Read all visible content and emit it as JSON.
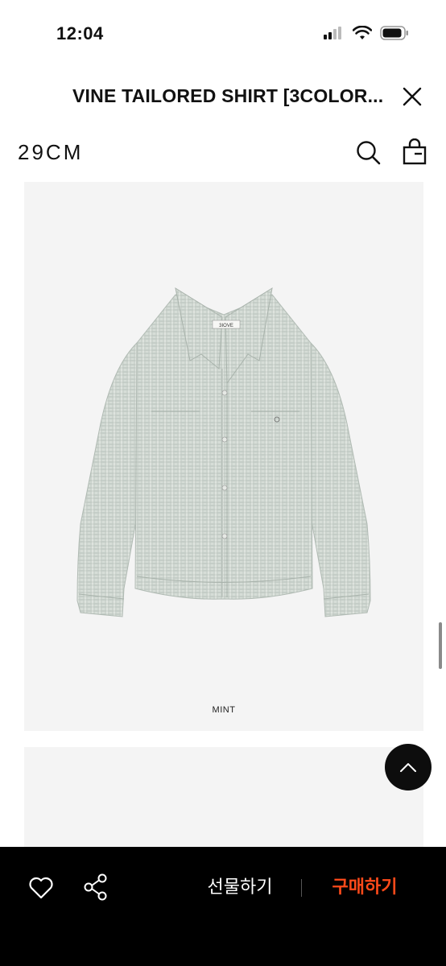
{
  "status_bar": {
    "time": "12:04",
    "icons": [
      "signal-icon",
      "wifi-icon",
      "battery-icon"
    ]
  },
  "modal": {
    "title": "VINE TAILORED SHIRT [3COLOR...",
    "close_icon": "close-icon"
  },
  "header": {
    "brand": "29CM",
    "icons": [
      "search-icon",
      "shopping-bag-icon"
    ]
  },
  "product_image": {
    "color_label": "MINT",
    "shirt_label": "3IOVE"
  },
  "scroll_top_icon": "chevron-up-icon",
  "bottom_bar": {
    "gift_label": "선물하기",
    "buy_label": "구매하기",
    "icons": [
      "heart-icon",
      "share-icon"
    ]
  },
  "colors": {
    "buy_accent": "#ff4a1a",
    "bottom_bar_bg": "#000000",
    "image_bg": "#f4f4f4"
  }
}
